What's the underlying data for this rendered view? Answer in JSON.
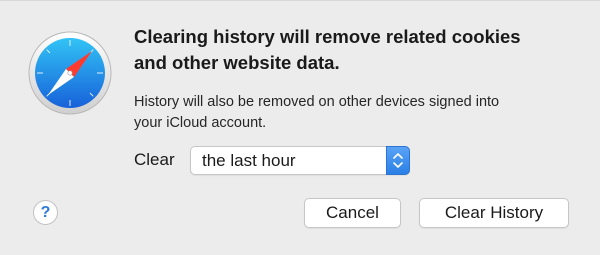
{
  "dialog": {
    "title_line1": "Clearing history will remove related cookies",
    "title_line2": "and other website data.",
    "message_line1": "History will also be removed on other devices signed into",
    "message_line2": "your iCloud account.",
    "clear_label": "Clear",
    "range_select": {
      "selected": "the last hour"
    },
    "help_label": "?",
    "cancel_label": "Cancel",
    "confirm_label": "Clear History",
    "app_icon": "safari-compass-icon",
    "accent_color": "#2a7fe6"
  }
}
